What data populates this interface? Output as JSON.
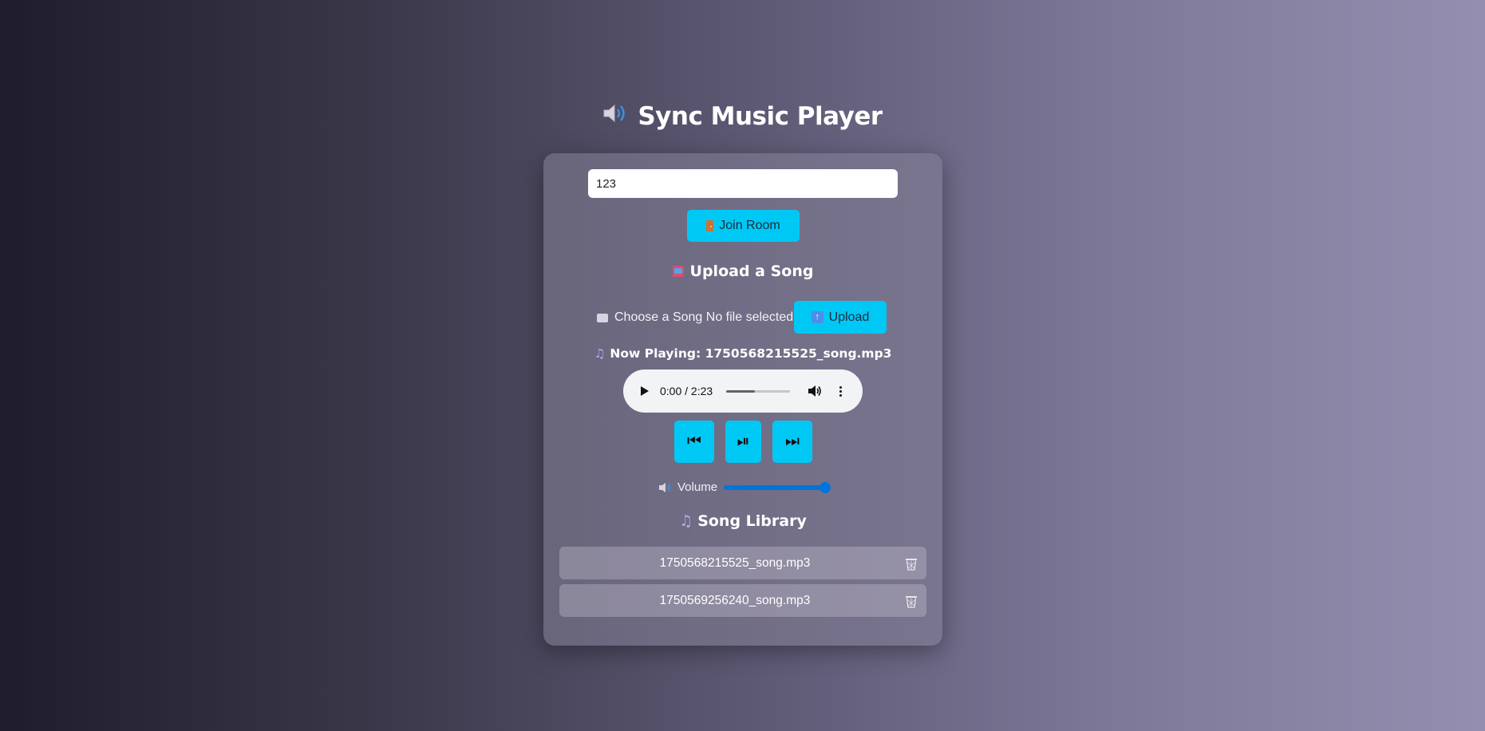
{
  "app": {
    "title": "Sync Music Player"
  },
  "room": {
    "value": "123",
    "join_label": "Join Room"
  },
  "upload": {
    "heading": "Upload a Song",
    "choose_label": "Choose a Song",
    "file_status": "No file selected",
    "button_label": "Upload"
  },
  "player": {
    "now_playing_label": "Now Playing:",
    "now_playing_file": "1750568215525_song.mp3",
    "time": "0:00 / 2:23",
    "buffered_fraction": 0.45,
    "controls": {
      "prev": "⏮",
      "play_pause": "⏯",
      "next": "⏭"
    },
    "volume_label": "Volume",
    "volume_level": 1.0
  },
  "library": {
    "heading": "Song Library",
    "songs": [
      {
        "name": "1750568215525_song.mp3"
      },
      {
        "name": "1750569256240_song.mp3"
      }
    ]
  },
  "colors": {
    "accent": "#00c8f5",
    "slider": "#0075d9"
  },
  "icons": {
    "title": "speaker-icon",
    "join": "door-icon",
    "upload_heading": "inbox-tray-icon",
    "file": "file-folder-icon",
    "upload_button": "up-arrow-icon",
    "now_playing": "music-note-icon",
    "volume": "speaker-icon",
    "library": "music-notes-icon",
    "delete": "wastebasket-icon"
  }
}
